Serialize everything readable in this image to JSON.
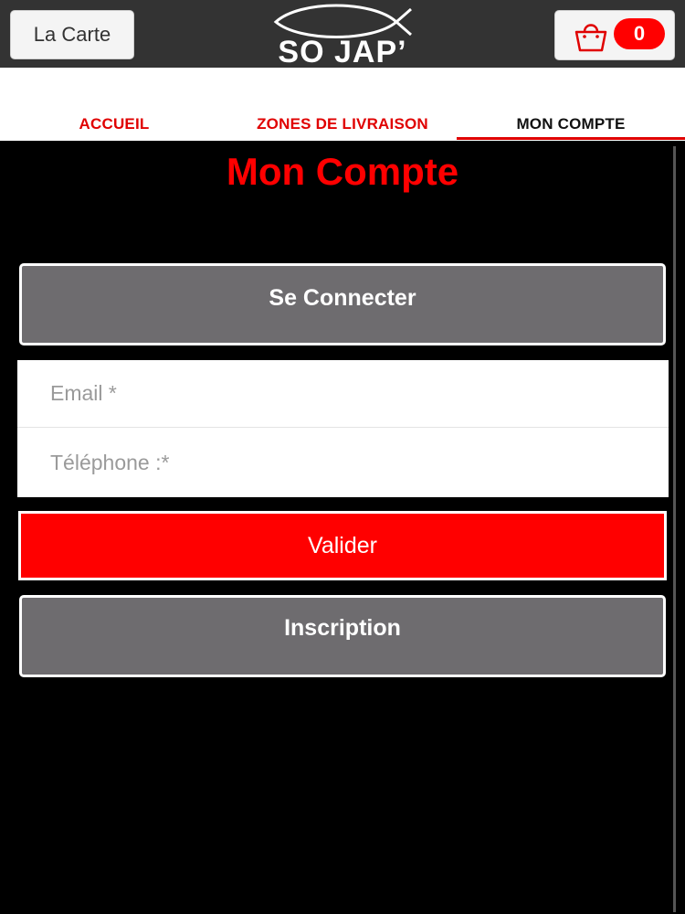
{
  "header": {
    "menu_button": "La Carte",
    "logo_text": "SO JAP’",
    "cart_count": "0"
  },
  "tabs": [
    {
      "label": "ACCUEIL",
      "active": false
    },
    {
      "label": "ZONES DE LIVRAISON",
      "active": false
    },
    {
      "label": "MON COMPTE",
      "active": true
    }
  ],
  "page": {
    "title": "Mon Compte",
    "login_button": "Se Connecter",
    "email_placeholder": "Email *",
    "phone_placeholder": "Téléphone :*",
    "submit_button": "Valider",
    "register_button": "Inscription"
  },
  "colors": {
    "accent": "#ff0000",
    "header_bg": "#333333",
    "button_gray": "#6e6c6f",
    "background": "#000000"
  },
  "icons": [
    "fish-logo-icon",
    "shopping-bag-icon"
  ]
}
